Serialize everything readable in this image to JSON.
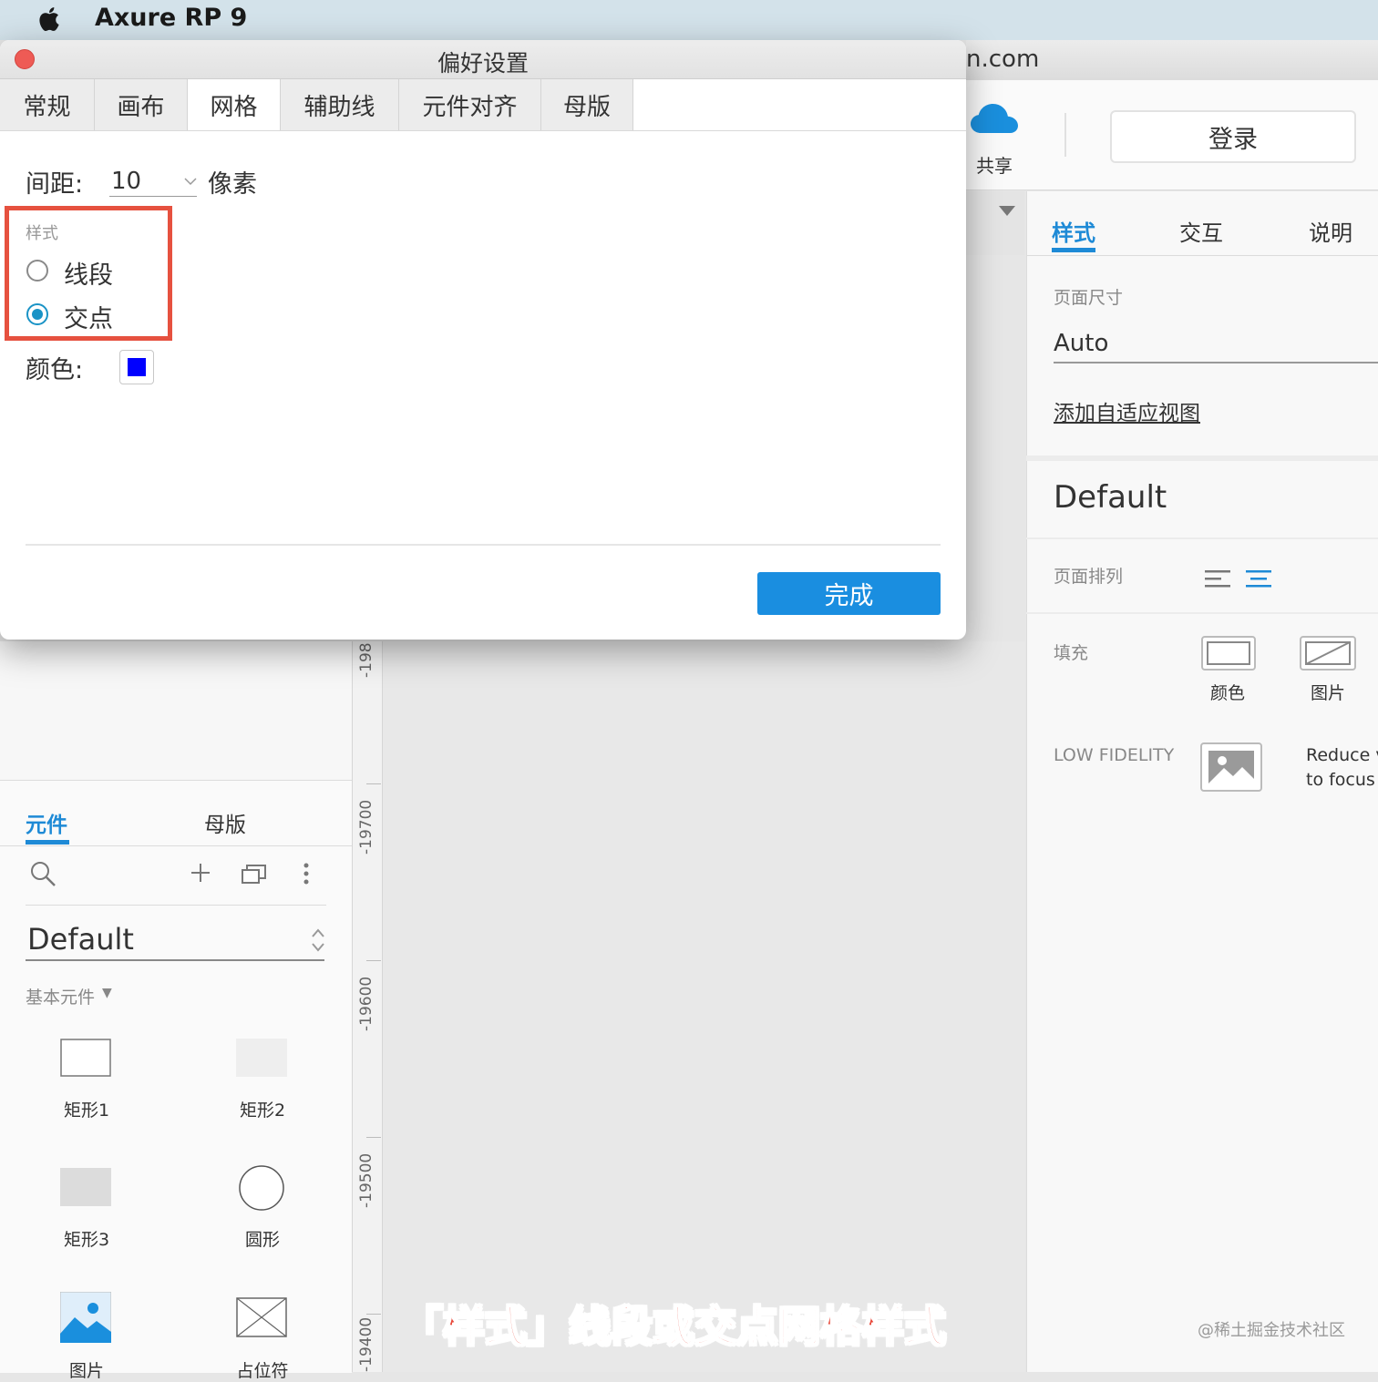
{
  "menubar": {
    "app_name": "Axure RP 9",
    "apple_icon": "apple-icon"
  },
  "main_window": {
    "title_fragment": "n.com",
    "toolbar": {
      "share_label": "共享",
      "login_label": "登录",
      "share_icon": "cloud-icon"
    }
  },
  "inspector": {
    "tabs": [
      "样式",
      "交互",
      "说明"
    ],
    "active_tab": "样式",
    "page_size_label": "页面尺寸",
    "page_size_value": "Auto",
    "adaptive_link": "添加自适应视图",
    "style_name": "Default",
    "page_align_label": "页面排列",
    "fill_label": "填充",
    "fill_color_label": "颜色",
    "fill_image_label": "图片",
    "lowfi_label": "LOW FIDELITY",
    "lowfi_desc_line1": "Reduce v",
    "lowfi_desc_line2": "to focus o"
  },
  "ruler": {
    "labels": [
      "-198",
      "-19700",
      "-19600",
      "-19500",
      "-19400"
    ]
  },
  "left_panel": {
    "tabs": [
      "元件",
      "母版"
    ],
    "active_tab": "元件",
    "library_name": "Default",
    "category_label": "基本元件",
    "category_caret": "▼",
    "widgets": [
      "矩形1",
      "矩形2",
      "矩形3",
      "圆形",
      "图片",
      "占位符"
    ]
  },
  "dialog": {
    "title": "偏好设置",
    "tabs": [
      "常规",
      "画布",
      "网格",
      "辅助线",
      "元件对齐",
      "母版"
    ],
    "active_tab": "网格",
    "spacing_label": "间距:",
    "spacing_value": "10",
    "spacing_unit": "像素",
    "style_group_label": "样式",
    "style_options": [
      "线段",
      "交点"
    ],
    "style_selected": "交点",
    "color_label": "颜色:",
    "grid_color": "#0000ff",
    "done_label": "完成"
  },
  "colors": {
    "accent": "#1e8ad6",
    "highlight": "#e6513f",
    "done_button": "#1a8ee0"
  },
  "caption": "「样式」线段或交点网格样式",
  "watermark": "@稀土掘金技术社区"
}
